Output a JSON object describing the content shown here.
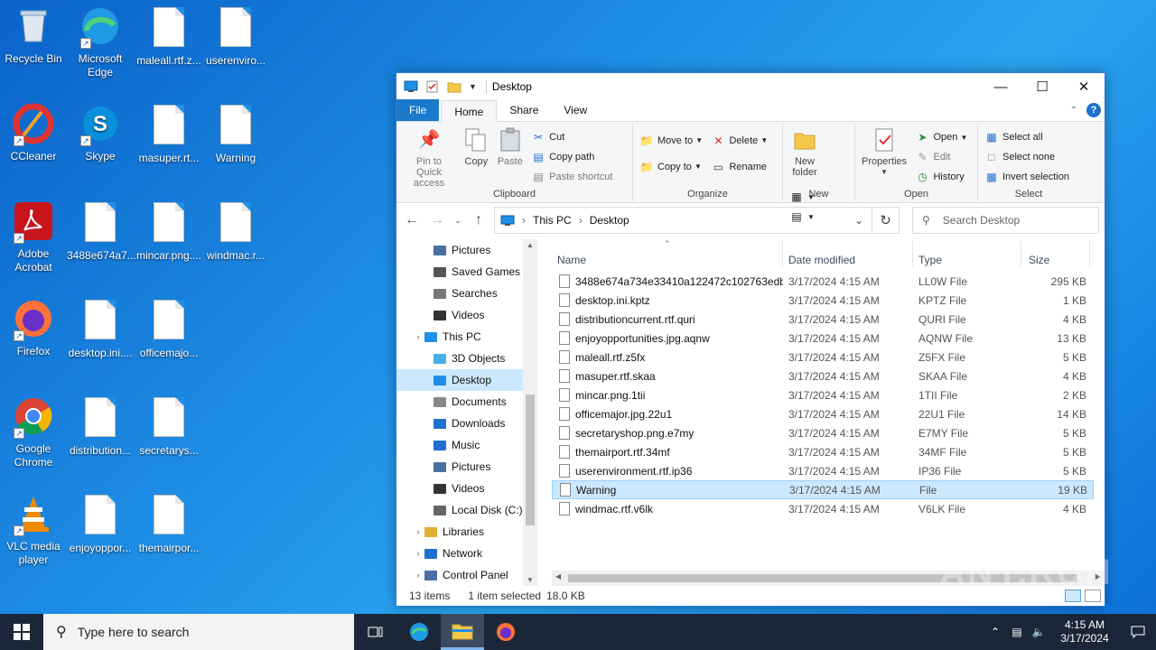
{
  "desktop_icons": [
    {
      "label": "Recycle Bin",
      "icon": "recycle-bin-icon"
    },
    {
      "label": "Microsoft Edge",
      "icon": "edge-icon"
    },
    {
      "label": "maleall.rtf.z...",
      "icon": "file-icon"
    },
    {
      "label": "userenviro...",
      "icon": "file-icon"
    },
    {
      "label": "CCleaner",
      "icon": "ccleaner-icon"
    },
    {
      "label": "Skype",
      "icon": "skype-icon"
    },
    {
      "label": "masuper.rt...",
      "icon": "file-icon"
    },
    {
      "label": "Warning",
      "icon": "file-icon"
    },
    {
      "label": "Adobe Acrobat",
      "icon": "acrobat-icon"
    },
    {
      "label": "3488e674a7...",
      "icon": "file-icon"
    },
    {
      "label": "mincar.png....",
      "icon": "file-icon"
    },
    {
      "label": "windmac.r...",
      "icon": "file-icon"
    },
    {
      "label": "Firefox",
      "icon": "firefox-icon"
    },
    {
      "label": "desktop.ini....",
      "icon": "file-icon"
    },
    {
      "label": "officemajo...",
      "icon": "file-icon"
    },
    {
      "label": "Google Chrome",
      "icon": "chrome-icon"
    },
    {
      "label": "distribution...",
      "icon": "file-icon"
    },
    {
      "label": "secretarys...",
      "icon": "file-icon"
    },
    {
      "label": "VLC media player",
      "icon": "vlc-icon"
    },
    {
      "label": "enjoyoppor...",
      "icon": "file-icon"
    },
    {
      "label": "themairpor...",
      "icon": "file-icon"
    }
  ],
  "window": {
    "title": "Desktop",
    "tabs": {
      "file": "File",
      "home": "Home",
      "share": "Share",
      "view": "View"
    },
    "ribbon": {
      "pin": "Pin to Quick access",
      "copy": "Copy",
      "paste": "Paste",
      "cut": "Cut",
      "copy_path": "Copy path",
      "paste_shortcut": "Paste shortcut",
      "clipboard": "Clipboard",
      "move_to": "Move to",
      "copy_to": "Copy to",
      "delete": "Delete",
      "rename": "Rename",
      "organize": "Organize",
      "new_folder": "New folder",
      "new": "New",
      "properties": "Properties",
      "open_btn": "Open",
      "edit": "Edit",
      "history": "History",
      "open": "Open",
      "select_all": "Select all",
      "select_none": "Select none",
      "invert": "Invert selection",
      "select": "Select"
    },
    "address": {
      "root": "This PC",
      "current": "Desktop"
    },
    "search_placeholder": "Search Desktop",
    "nav": [
      {
        "label": "Pictures",
        "icon": "pictures-icon",
        "level": 2
      },
      {
        "label": "Saved Games",
        "icon": "saved-games-icon",
        "level": 2
      },
      {
        "label": "Searches",
        "icon": "searches-icon",
        "level": 2
      },
      {
        "label": "Videos",
        "icon": "videos-icon",
        "level": 2
      },
      {
        "label": "This PC",
        "icon": "this-pc-icon",
        "level": 1
      },
      {
        "label": "3D Objects",
        "icon": "3d-objects-icon",
        "level": 2
      },
      {
        "label": "Desktop",
        "icon": "desktop-icon",
        "level": 2,
        "selected": true
      },
      {
        "label": "Documents",
        "icon": "documents-icon",
        "level": 2
      },
      {
        "label": "Downloads",
        "icon": "downloads-icon",
        "level": 2
      },
      {
        "label": "Music",
        "icon": "music-icon",
        "level": 2
      },
      {
        "label": "Pictures",
        "icon": "pictures-icon",
        "level": 2
      },
      {
        "label": "Videos",
        "icon": "videos-icon",
        "level": 2
      },
      {
        "label": "Local Disk (C:)",
        "icon": "disk-icon",
        "level": 2
      },
      {
        "label": "Libraries",
        "icon": "libraries-icon",
        "level": 1
      },
      {
        "label": "Network",
        "icon": "network-icon",
        "level": 1
      },
      {
        "label": "Control Panel",
        "icon": "control-panel-icon",
        "level": 1
      }
    ],
    "columns": {
      "name": "Name",
      "date": "Date modified",
      "type": "Type",
      "size": "Size"
    },
    "files": [
      {
        "name": "3488e674a734e33410a122472c102763edb...",
        "date": "3/17/2024 4:15 AM",
        "type": "LL0W File",
        "size": "295 KB"
      },
      {
        "name": "desktop.ini.kptz",
        "date": "3/17/2024 4:15 AM",
        "type": "KPTZ File",
        "size": "1 KB"
      },
      {
        "name": "distributioncurrent.rtf.quri",
        "date": "3/17/2024 4:15 AM",
        "type": "QURI File",
        "size": "4 KB"
      },
      {
        "name": "enjoyopportunities.jpg.aqnw",
        "date": "3/17/2024 4:15 AM",
        "type": "AQNW File",
        "size": "13 KB"
      },
      {
        "name": "maleall.rtf.z5fx",
        "date": "3/17/2024 4:15 AM",
        "type": "Z5FX File",
        "size": "5 KB"
      },
      {
        "name": "masuper.rtf.skaa",
        "date": "3/17/2024 4:15 AM",
        "type": "SKAA File",
        "size": "4 KB"
      },
      {
        "name": "mincar.png.1tii",
        "date": "3/17/2024 4:15 AM",
        "type": "1TII File",
        "size": "2 KB"
      },
      {
        "name": "officemajor.jpg.22u1",
        "date": "3/17/2024 4:15 AM",
        "type": "22U1 File",
        "size": "14 KB"
      },
      {
        "name": "secretaryshop.png.e7my",
        "date": "3/17/2024 4:15 AM",
        "type": "E7MY File",
        "size": "5 KB"
      },
      {
        "name": "themairport.rtf.34mf",
        "date": "3/17/2024 4:15 AM",
        "type": "34MF File",
        "size": "5 KB"
      },
      {
        "name": "userenvironment.rtf.ip36",
        "date": "3/17/2024 4:15 AM",
        "type": "IP36 File",
        "size": "5 KB"
      },
      {
        "name": "Warning",
        "date": "3/17/2024 4:15 AM",
        "type": "File",
        "size": "19 KB",
        "selected": true
      },
      {
        "name": "windmac.rtf.v6lk",
        "date": "3/17/2024 4:15 AM",
        "type": "V6LK File",
        "size": "4 KB"
      }
    ],
    "status": {
      "count": "13 items",
      "selected": "1 item selected",
      "size": "18.0 KB"
    }
  },
  "taskbar": {
    "search_placeholder": "Type here to search",
    "time": "4:15 AM",
    "date": "3/17/2024"
  },
  "watermark": "ANY.RUN",
  "colors": {
    "accent": "#1979ca",
    "selection": "#cce8ff",
    "taskbar": "#1b2738"
  }
}
